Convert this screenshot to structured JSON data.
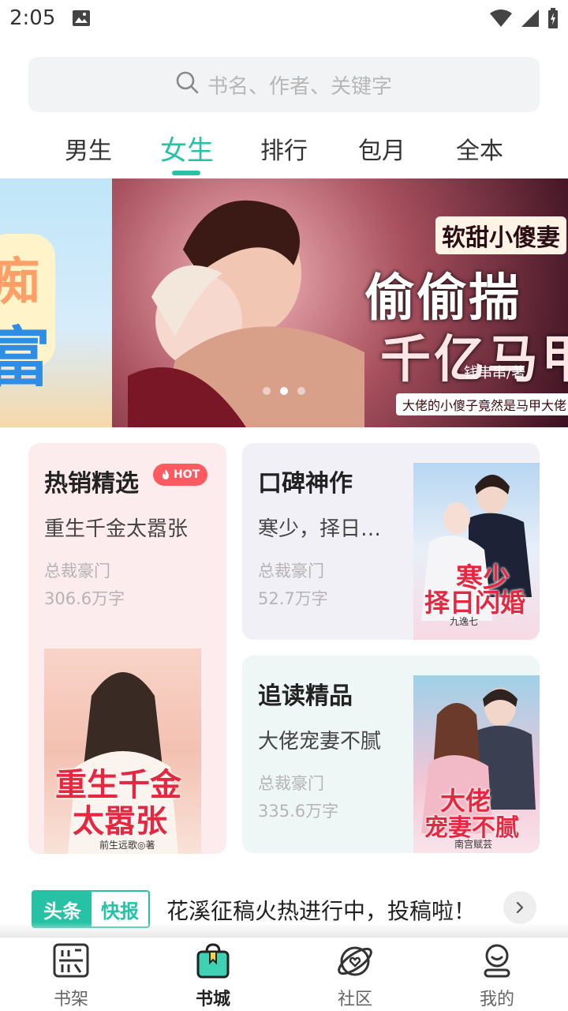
{
  "status_bar": {
    "time": "2:05",
    "icons": [
      "image-icon",
      "wifi-icon",
      "signal-icon",
      "battery-charging-icon"
    ]
  },
  "search": {
    "placeholder": "书名、作者、关键字",
    "icon": "search-icon"
  },
  "tabs": [
    {
      "label": "男生",
      "active": false
    },
    {
      "label": "女生",
      "active": true
    },
    {
      "label": "排行",
      "active": false
    },
    {
      "label": "包月",
      "active": false
    },
    {
      "label": "全本",
      "active": false
    }
  ],
  "banner": {
    "subtitle": "软甜小傻妻",
    "title_line1": "偷偷揣",
    "title_line2": "千亿马甲",
    "author": "钱串串/著",
    "tagline": "大佬的小傻子竟然是马甲大佬",
    "active_slide": 2,
    "slides": 3
  },
  "cards": {
    "hot": {
      "title": "热销精选",
      "badge": "HOT",
      "book_name": "重生千金太嚣张",
      "genre": "总裁豪门",
      "words": "306.6万字",
      "cover_title_line1": "重生千金",
      "cover_title_line2": "太嚣张",
      "cover_author": "前生远歌◎著"
    },
    "praise": {
      "title": "口碑神作",
      "book_name": "寒少，择日…",
      "genre": "总裁豪门",
      "words": "52.7万字",
      "cover_title_line1": "寒少",
      "cover_title_line2": "择日闪婚",
      "cover_author": "九逸七"
    },
    "follow": {
      "title": "追读精品",
      "book_name": "大佬宠妻不腻",
      "genre": "总裁豪门",
      "words": "335.6万字",
      "cover_title_line1": "大佬",
      "cover_title_line2": "宠妻不腻",
      "cover_author": "南宫赋芸"
    }
  },
  "news": {
    "logo_part1": "头条",
    "logo_part2": "快报",
    "text": "花溪征稿火热进行中，投稿啦！"
  },
  "bottom_nav": [
    {
      "label": "书架",
      "icon": "bookshelf-icon",
      "active": false
    },
    {
      "label": "书城",
      "icon": "bookstore-bag-icon",
      "active": true
    },
    {
      "label": "社区",
      "icon": "community-planet-icon",
      "active": false
    },
    {
      "label": "我的",
      "icon": "profile-icon",
      "active": false
    }
  ],
  "colors": {
    "accent": "#27c2a6",
    "hot_badge": "#ff5a5f",
    "hot_card_bg": "#fcecee",
    "praise_card_bg": "#f1f0f6",
    "follow_card_bg": "#eef7f6"
  }
}
